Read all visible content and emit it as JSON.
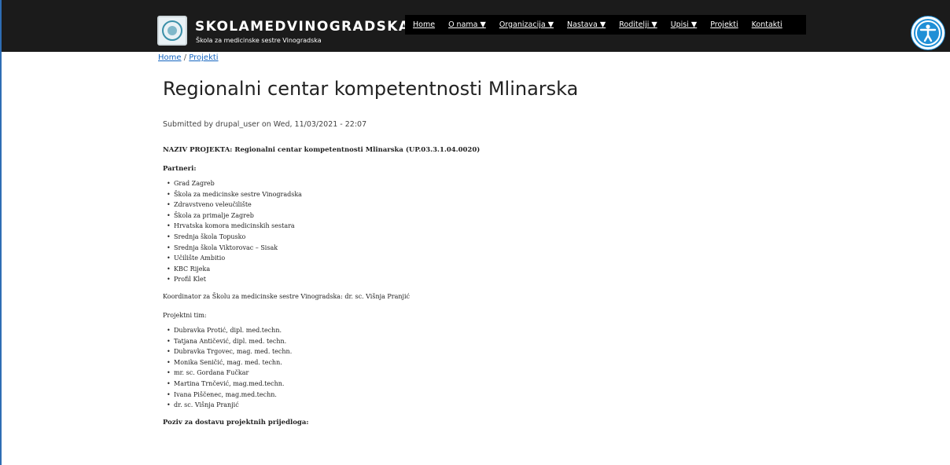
{
  "header": {
    "site_title": "SKOLAMEDVINOGRADSKA",
    "site_subtitle": "Škola za medicinske sestre Vinogradska",
    "nav": [
      "Home",
      "O nama ▼",
      "Organizacija ▼",
      "Nastava ▼",
      "Roditelji ▼",
      "Upisi ▼",
      "Projekti",
      "Kontakti"
    ],
    "accessibility_icon": "accessibility-icon"
  },
  "breadcrumb": {
    "home": "Home",
    "sep": "/",
    "current": "Projekti"
  },
  "page": {
    "title": "Regionalni centar kompetentnosti Mlinarska",
    "submitted": "Submitted by drupal_user on Wed, 11/03/2021 - 22:07"
  },
  "content": {
    "project_name": "NAZIV PROJEKTA: Regionalni centar kompetentnosti Mlinarska (UP.03.3.1.04.0020)",
    "partners_heading": "Partneri:",
    "partners": [
      "Grad Zagreb",
      "Škola za medicinske sestre Vinogradska",
      "Zdravstveno veleučilište",
      "Škola za primalje Zagreb",
      "Hrvatska komora medicinskih sestara",
      "Srednja škola Topusko",
      "Srednja škola Viktorovac – Sisak",
      "Učilište Ambitio",
      "KBC Rijeka",
      "Profil Klet"
    ],
    "coordinator": "Koordinator za Školu za medicinske sestre Vinogradska: dr. sc. Višnja Pranjić",
    "team_heading": "Projektni tim:",
    "team": [
      "Dubravka Protić, dipl. med.techn.",
      "Tatjana Antičević, dipl. med. techn.",
      "Dubravka Trgovec, mag. med. techn.",
      "Monika Seničić, mag. med. techn.",
      "mr. sc. Gordana Fučkar",
      "Martina Trnčević, mag.med.techn.",
      "Ivana Piščenec, mag.med.techn.",
      "dr. sc. Višnja Pranjić"
    ],
    "call_heading": "Poziv za dostavu projektnih prijedloga:"
  }
}
